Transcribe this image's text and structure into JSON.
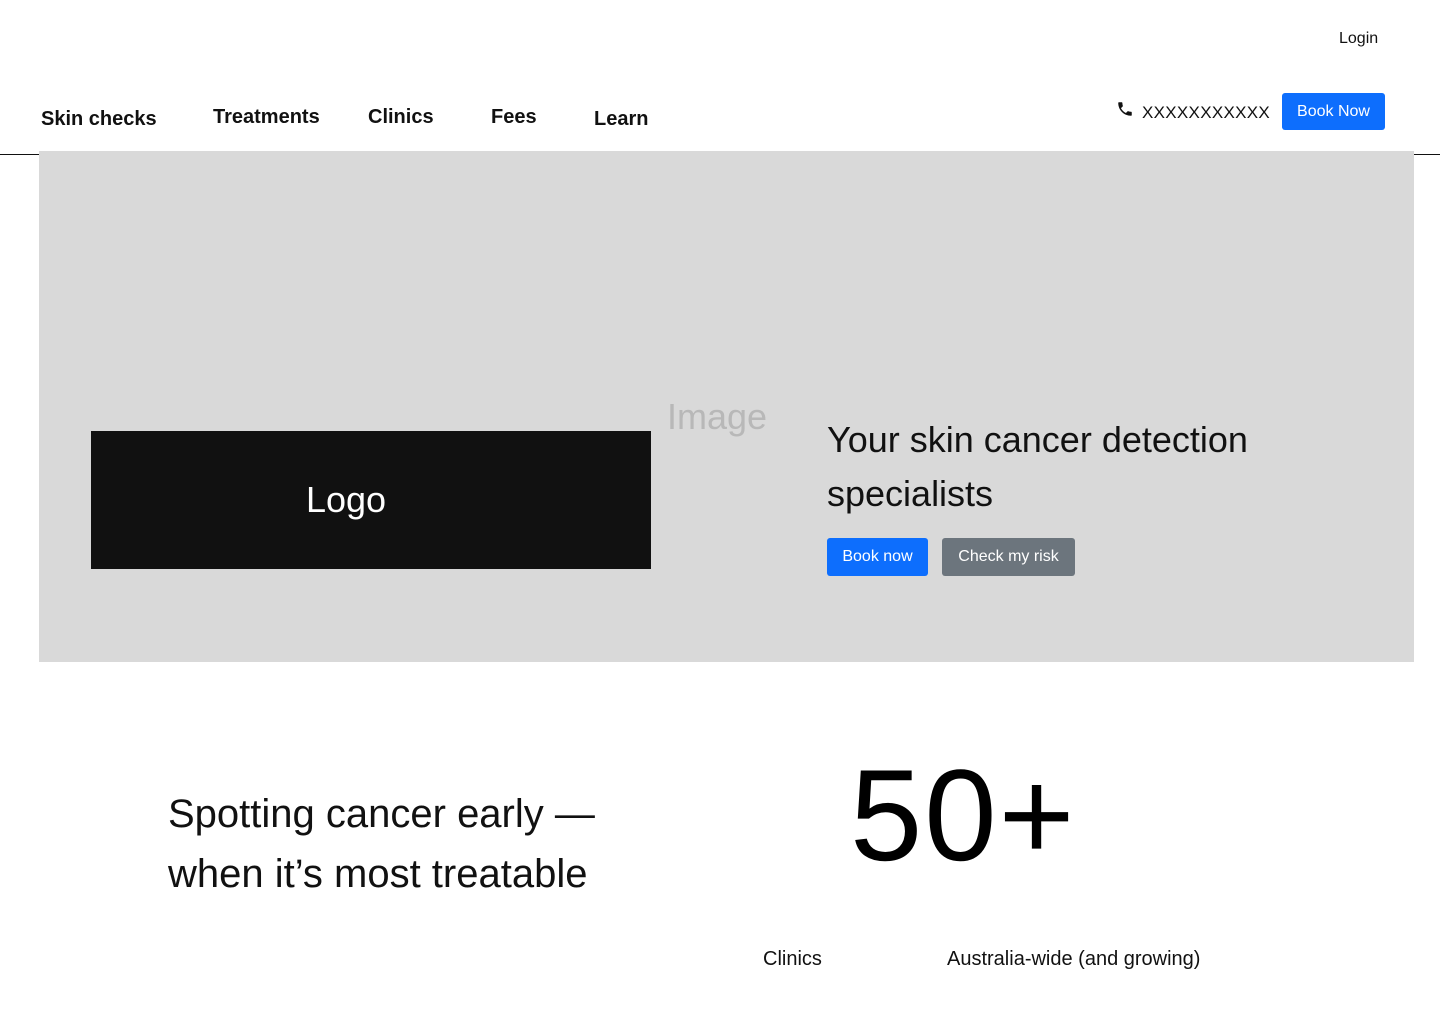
{
  "header": {
    "login_label": "Login",
    "nav": [
      {
        "label": "Skin checks"
      },
      {
        "label": "Treatments"
      },
      {
        "label": "Clinics"
      },
      {
        "label": "Fees"
      },
      {
        "label": "Learn"
      }
    ],
    "phone": {
      "icon": "phone-icon",
      "number": "XXXXXXXXXXX"
    },
    "book_now_label": "Book Now"
  },
  "hero": {
    "image_placeholder": "Image",
    "logo_placeholder": "Logo",
    "headline": "Your skin cancer detection specialists",
    "primary_button": "Book now",
    "secondary_button": "Check my risk"
  },
  "stats": {
    "tagline_line1": "Spotting cancer early —",
    "tagline_line2": "when it’s most treatable",
    "number": "50+",
    "label": "Clinics",
    "description": "Australia-wide (and growing)"
  },
  "colors": {
    "primary": "#0d6efd",
    "secondary": "#6c757d",
    "hero_bg": "#d9d9d9",
    "logo_bg": "#111111"
  }
}
